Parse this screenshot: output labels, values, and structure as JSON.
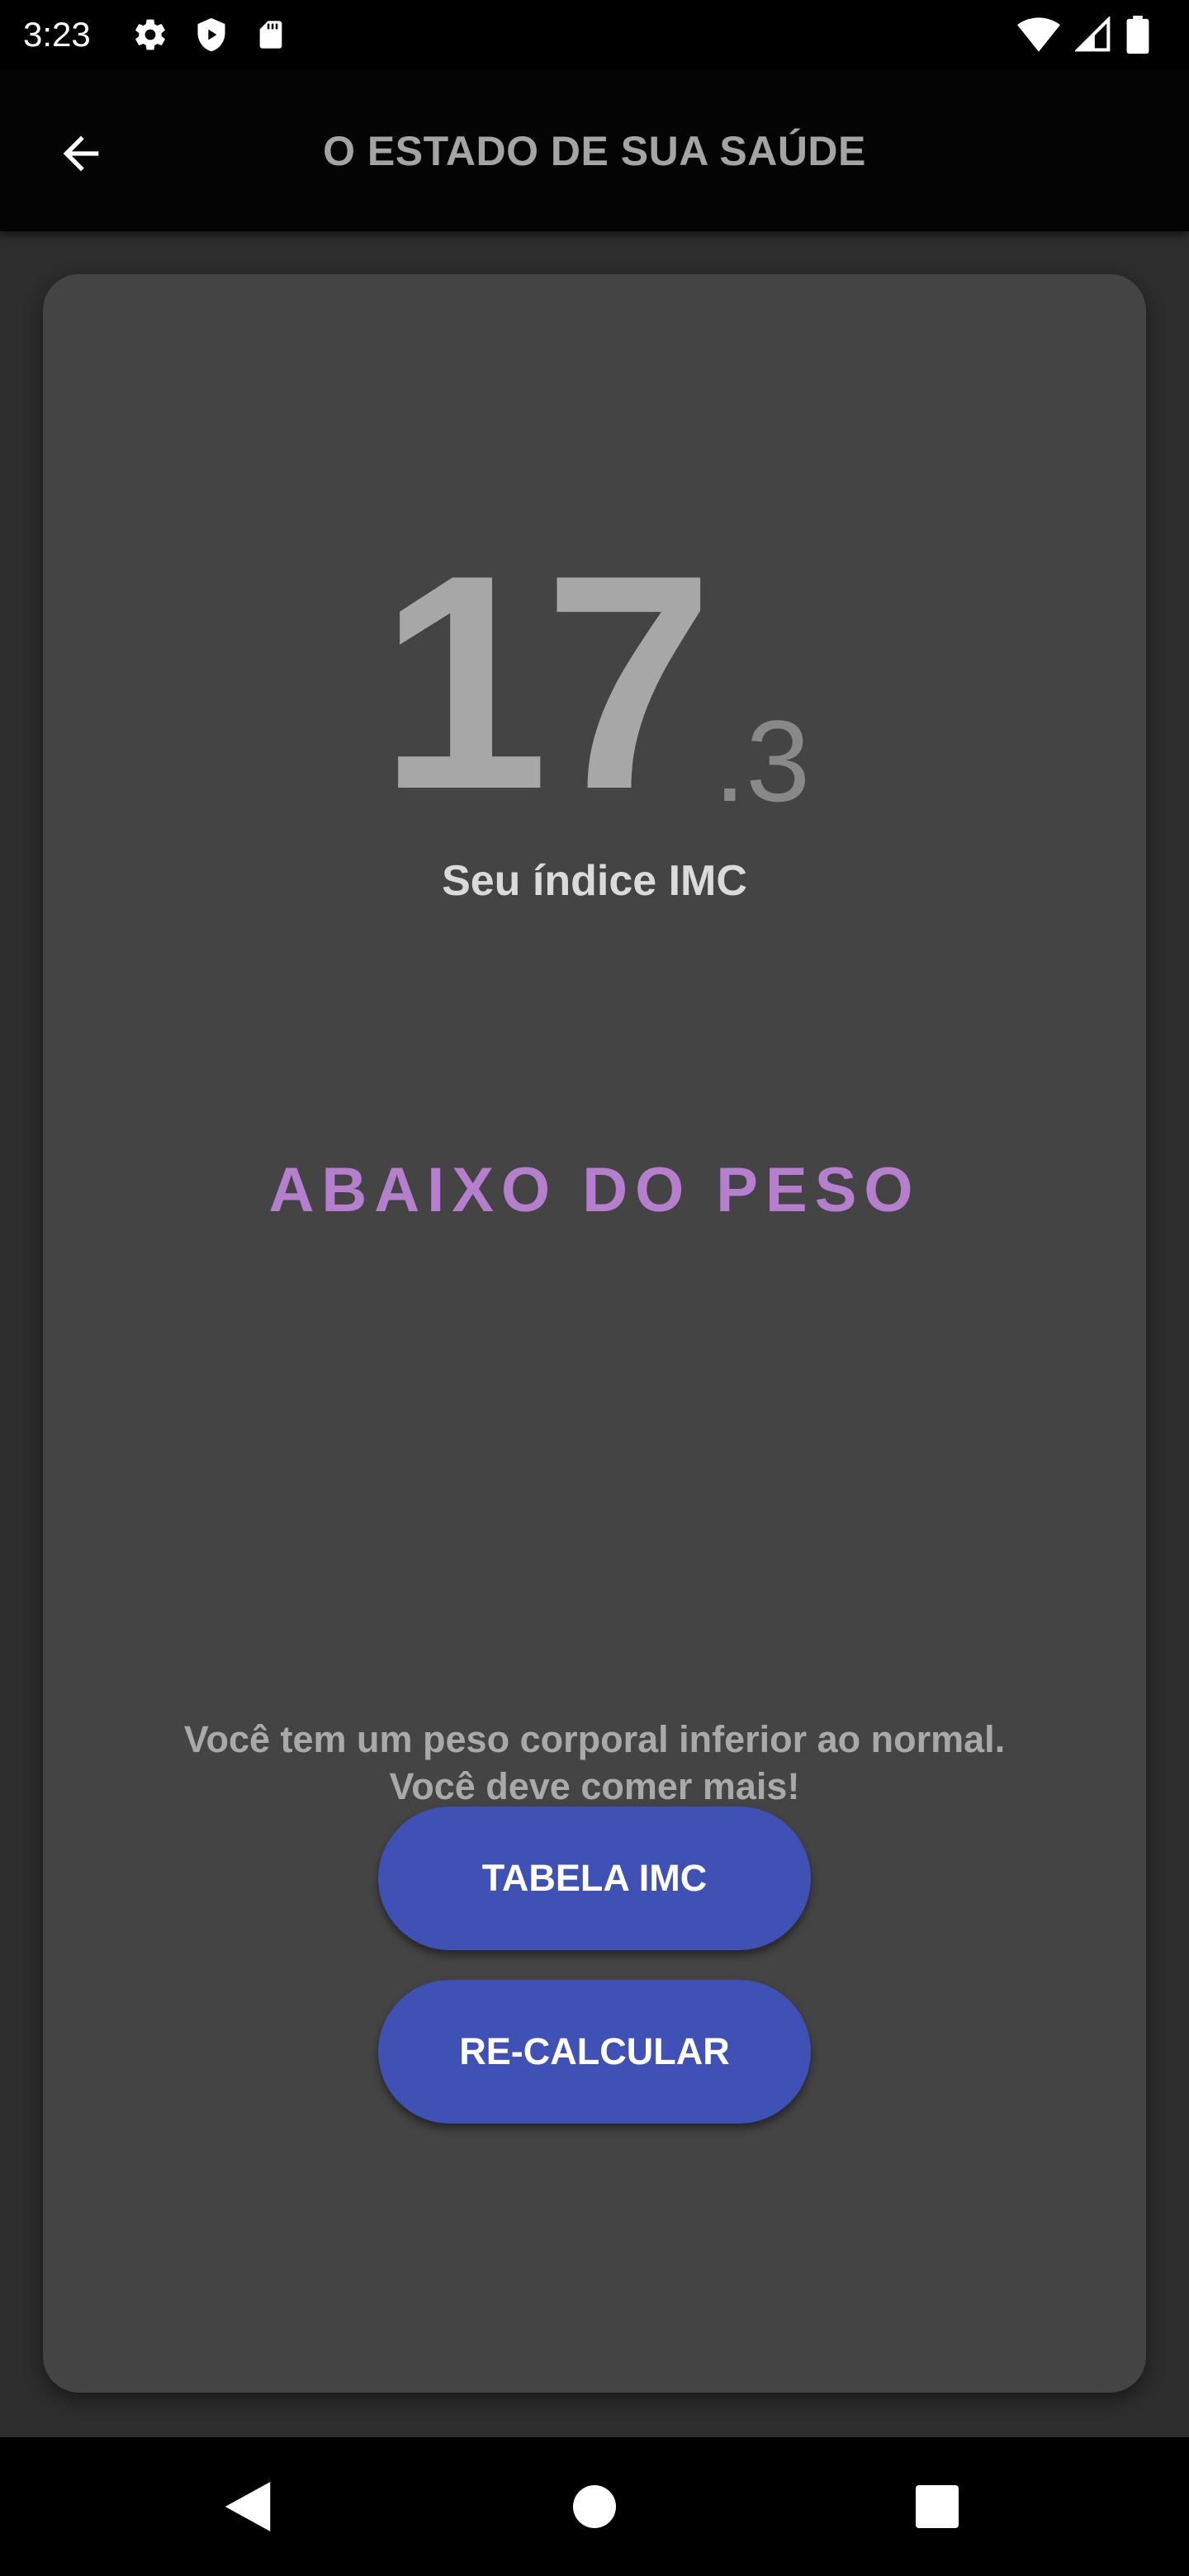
{
  "status_bar": {
    "time": "3:23",
    "left_icons": [
      "settings-icon",
      "shield-icon",
      "sd-card-icon"
    ],
    "right_icons": [
      "wifi-icon",
      "signal-icon",
      "battery-icon"
    ]
  },
  "app_bar": {
    "title": "O ESTADO DE SUA SAÚDE",
    "back_icon": "arrow-back-icon"
  },
  "result": {
    "bmi_integer": "17",
    "bmi_decimal": ".3",
    "caption": "Seu índice IMC",
    "status": "ABAIXO DO PESO",
    "status_color": "#b57fcd",
    "message_line1": "Você tem um peso corporal inferior ao normal.",
    "message_line2": "Você deve comer mais!"
  },
  "buttons": {
    "table_label": "TABELA IMC",
    "recalc_label": "RE-CALCULAR",
    "button_color": "#3f51b5"
  },
  "nav_bar": {
    "icons": [
      "nav-back-icon",
      "nav-home-icon",
      "nav-recents-icon"
    ]
  }
}
